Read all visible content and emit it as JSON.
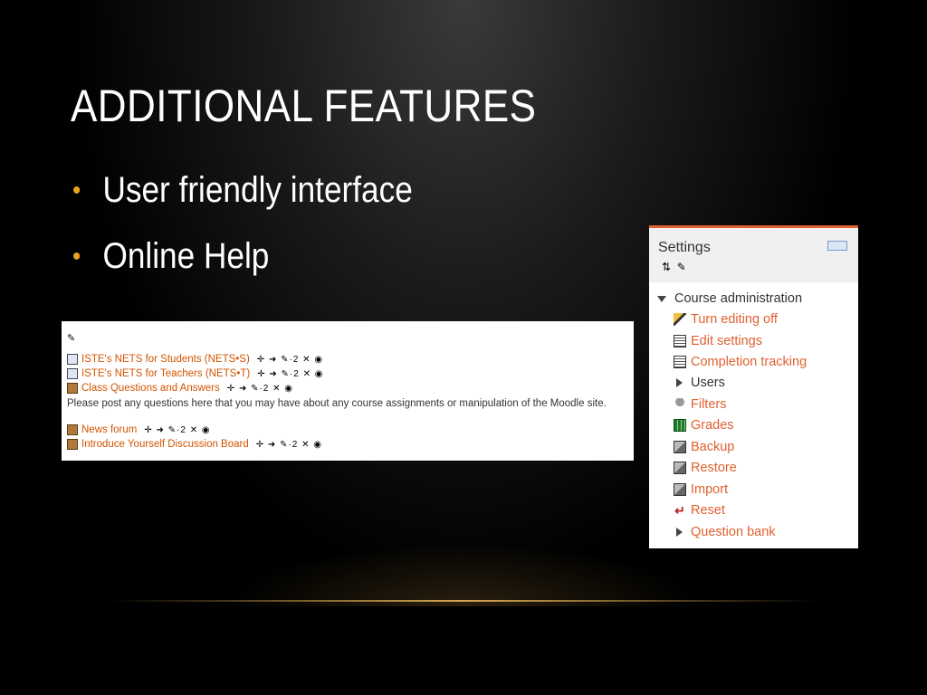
{
  "slide": {
    "title": "ADDITIONAL FEATURES",
    "bullets": [
      "User friendly interface",
      "Online Help"
    ]
  },
  "course_panel": {
    "items": [
      {
        "label": "ISTE's NETS for Students (NETS•S)",
        "icon": "page-icon"
      },
      {
        "label": "ISTE's NETS for Teachers (NETS•T)",
        "icon": "page-icon"
      },
      {
        "label": "Class Questions and Answers",
        "icon": "forum-icon"
      }
    ],
    "description": "Please post any questions here that you may have about any course assignments or manipulation of the Moodle site.",
    "items2": [
      {
        "label": "News forum",
        "icon": "forum-icon"
      },
      {
        "label": "Introduce Yourself Discussion Board",
        "icon": "forum-icon"
      }
    ],
    "actions": "✛ ➜ ✎·2 ✕ ◉",
    "actions_short": "✛ ➜ ✎·2 ✕ ◉"
  },
  "settings": {
    "title": "Settings",
    "section": "Course administration",
    "items": [
      {
        "label": "Turn editing off",
        "kind": "link",
        "icon": "edit-icon"
      },
      {
        "label": "Edit settings",
        "kind": "link",
        "icon": "document-icon"
      },
      {
        "label": "Completion tracking",
        "kind": "link",
        "icon": "document-icon"
      },
      {
        "label": "Users",
        "kind": "branch",
        "icon": "expand-icon"
      },
      {
        "label": "Filters",
        "kind": "link",
        "icon": "filter-icon"
      },
      {
        "label": "Grades",
        "kind": "link",
        "icon": "grades-icon"
      },
      {
        "label": "Backup",
        "kind": "link",
        "icon": "backup-icon"
      },
      {
        "label": "Restore",
        "kind": "link",
        "icon": "restore-icon"
      },
      {
        "label": "Import",
        "kind": "link",
        "icon": "import-icon"
      },
      {
        "label": "Reset",
        "kind": "link",
        "icon": "reset-icon"
      },
      {
        "label": "Question bank",
        "kind": "branch",
        "icon": "expand-icon"
      }
    ]
  },
  "colors": {
    "accent_link": "#e06030",
    "bullet": "#e8a21c"
  }
}
